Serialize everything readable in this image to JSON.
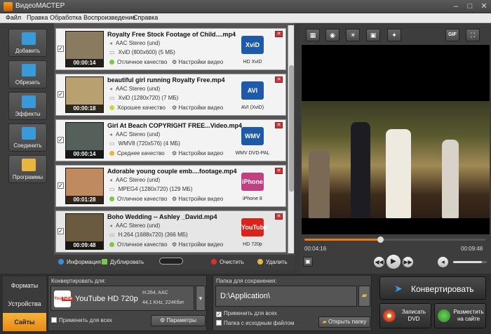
{
  "app": {
    "title": "ВидеоМАСТЕР"
  },
  "menu": [
    "Файл",
    "Правка",
    "Обработка",
    "Воспроизведение",
    "Справка"
  ],
  "sidebar": [
    {
      "label": "Добавить",
      "icon": "add-film-icon",
      "color": "#3a9ad9"
    },
    {
      "label": "Обрезать",
      "icon": "cut-film-icon",
      "color": "#3a9ad9"
    },
    {
      "label": "Эффекты",
      "icon": "effects-film-icon",
      "color": "#3a9ad9"
    },
    {
      "label": "Соединить",
      "icon": "join-film-icon",
      "color": "#3a9ad9"
    },
    {
      "label": "Программы",
      "icon": "programs-icon",
      "color": "#e8b640"
    }
  ],
  "files": [
    {
      "name": "Royalty Free Stock Footage of Child....mp4",
      "audio": "AAC Stereo (und)",
      "video": "XviD (800x600) (5 МБ)",
      "quality": "Отличное качество",
      "quality_color": "#7ac943",
      "settings": "Настройки видео",
      "duration": "00:00:14",
      "format": "XviD",
      "format_label": "HD XviD",
      "format_color": "#1f5aa8",
      "thumb": "#8a7a60"
    },
    {
      "name": "beautiful girl running Royalty Free.mp4",
      "audio": "AAC Stereo (und)",
      "video": "XviD (1280x720) (7 МБ)",
      "quality": "Хорошее качество",
      "quality_color": "#c9d43a",
      "settings": "Настройки видео",
      "duration": "00:00:18",
      "format": "AVI",
      "format_label": "AVI (XviD)",
      "format_color": "#1f5aa8",
      "thumb": "#b8a070"
    },
    {
      "name": "Girl At Beach COPYRIGHT FREE...Video.mp4",
      "audio": "AAC Stereo (und)",
      "video": "WMV8 (720x576) (4 МБ)",
      "quality": "Среднее качество",
      "quality_color": "#e8b640",
      "settings": "Настройки видео",
      "duration": "00:00:14",
      "format": "WMV",
      "format_label": "WMV DVD-PAL",
      "format_color": "#1f5aa8",
      "thumb": "#56605a"
    },
    {
      "name": "Adorable young couple emb....footage.mp4",
      "audio": "AAC Stereo (und)",
      "video": "MPEG4 (1280x720) (129 МБ)",
      "quality": "Отличное качество",
      "quality_color": "#7ac943",
      "settings": "Настройки видео",
      "duration": "00:01:28",
      "format": "iPhone",
      "format_label": "iPhone 8",
      "format_color": "#c04080",
      "thumb": "#c08a60"
    },
    {
      "name": "Boho Wedding -- Ashley _David.mp4",
      "audio": "AAC Stereo (und)",
      "video": "H.264 (1688x720) (366 МБ)",
      "quality": "Отличное качество",
      "quality_color": "#7ac943",
      "settings": "Настройки видео",
      "duration": "00:09:48",
      "format": "YouTube",
      "format_label": "HD 720p",
      "format_color": "#d8241c",
      "thumb": "#6a5a40"
    }
  ],
  "list_tools": {
    "info": "Информация",
    "duplicate": "Дублировать",
    "clear": "Очистить",
    "delete": "Удалить"
  },
  "player": {
    "current_time": "00:04:16",
    "total_time": "00:09:48",
    "progress": 0.42,
    "gif_label": "GIF"
  },
  "bottom": {
    "tabs": [
      "Форматы",
      "Устройства",
      "Сайты"
    ],
    "active_tab": "Сайты",
    "convert_for_label": "Конвертировать для:",
    "profile_name": "YouTube HD 720p",
    "profile_codec": "H.264, AAC",
    "profile_audio": "44,1 KHz, 224Кбит",
    "apply_all": "Применить для всех",
    "params_button": "Параметры",
    "save_folder_label": "Папка для сохранения:",
    "save_path": "D:\\Application\\",
    "apply_all_save": "Применить для всех",
    "same_folder": "Папка с исходным файлом",
    "open_folder": "Открыть папку",
    "convert_button": "Конвертировать",
    "burn_dvd": "Записать DVD",
    "publish": "Разместить на сайте"
  },
  "colors": {
    "accent": "#f07a10",
    "tab_active": "#f0a02a"
  }
}
